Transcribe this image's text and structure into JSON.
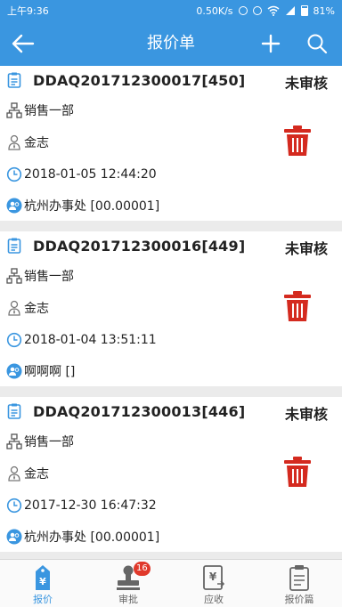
{
  "status_bar": {
    "time": "上午9:36",
    "speed": "0.50K/s",
    "battery": "81%"
  },
  "app_bar": {
    "title": "报价单"
  },
  "orders": [
    {
      "code": "DDAQ201712300017[450]",
      "status": "未审核",
      "department": "销售一部",
      "person": "金志",
      "datetime": "2018-01-05 12:44:20",
      "customer": "杭州办事处 [00.00001]"
    },
    {
      "code": "DDAQ201712300016[449]",
      "status": "未审核",
      "department": "销售一部",
      "person": "金志",
      "datetime": "2018-01-04 13:51:11",
      "customer": "啊啊啊 []"
    },
    {
      "code": "DDAQ201712300013[446]",
      "status": "未审核",
      "department": "销售一部",
      "person": "金志",
      "datetime": "2017-12-30 16:47:32",
      "customer": "杭州办事处 [00.00001]"
    }
  ],
  "tabs": [
    {
      "label": "报价",
      "active": true
    },
    {
      "label": "审批",
      "badge": "16"
    },
    {
      "label": "应收"
    },
    {
      "label": "报价篇"
    }
  ],
  "colors": {
    "primary": "#3a96e0",
    "delete": "#d42a1f",
    "badge": "#e0392b"
  }
}
